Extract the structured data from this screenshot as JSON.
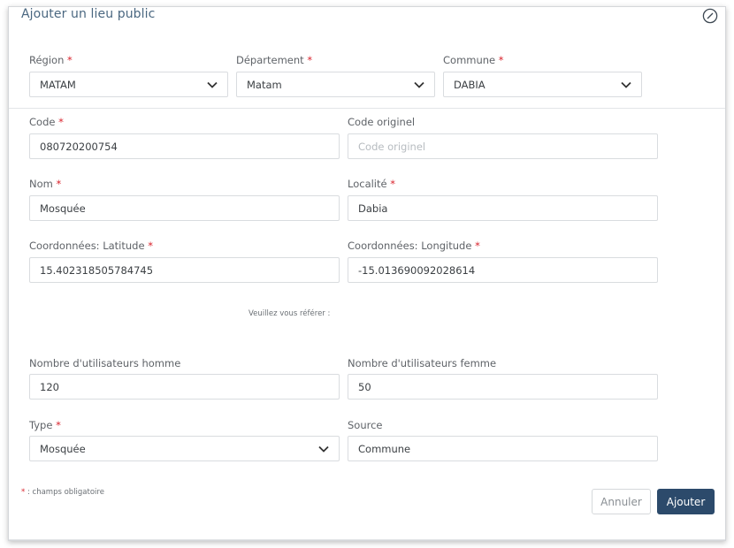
{
  "modal": {
    "title": "Ajouter un lieu public",
    "close_icon": "close-circle-icon"
  },
  "location": {
    "region": {
      "label": "Région",
      "required_mark": "*",
      "value": "MATAM"
    },
    "departement": {
      "label": "Département",
      "required_mark": "*",
      "value": "Matam"
    },
    "commune": {
      "label": "Commune",
      "required_mark": "*",
      "value": "DABIA"
    }
  },
  "form": {
    "code": {
      "label": "Code",
      "required_mark": "*",
      "value": "080720200754"
    },
    "code_originel": {
      "label": "Code originel",
      "placeholder": "Code originel"
    },
    "nom": {
      "label": "Nom",
      "required_mark": "*",
      "value": "Mosquée"
    },
    "localite": {
      "label": "Localité",
      "required_mark": "*",
      "value": "Dabia"
    },
    "latitude": {
      "label": "Coordonnées: Latitude",
      "required_mark": "*",
      "value": "15.402318505784745"
    },
    "longitude": {
      "label": "Coordonnées: Longitude",
      "required_mark": "*",
      "value": "-15.013690092028614"
    },
    "note": "Veuillez vous référer :",
    "users_homme": {
      "label": "Nombre d'utilisateurs homme",
      "value": "120"
    },
    "users_femme": {
      "label": "Nombre d'utilisateurs femme",
      "value": "50"
    },
    "type": {
      "label": "Type",
      "required_mark": "*",
      "value": "Mosquée"
    },
    "source": {
      "label": "Source",
      "value": "Commune"
    }
  },
  "footer": {
    "required_mark": "*",
    "required_note": " : champs obligatoire",
    "cancel_label": "Annuler",
    "submit_label": "Ajouter"
  },
  "colors": {
    "primary": "#2c4a6b",
    "required": "#d9232d",
    "title": "#4a6780"
  }
}
